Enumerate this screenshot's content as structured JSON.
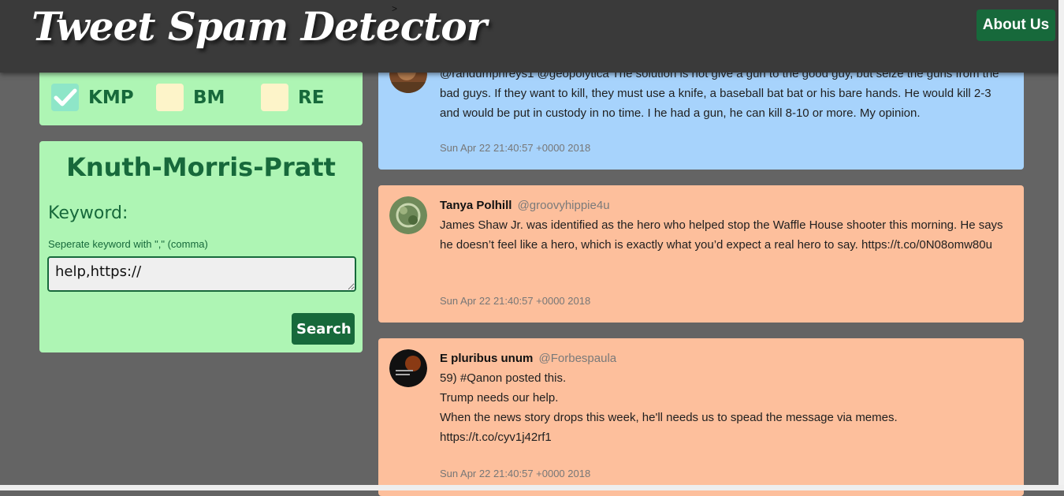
{
  "header": {
    "brand": "Tweet Spam Detector",
    "about_label": "About Us",
    "caret": ">"
  },
  "algorithms": {
    "options": [
      {
        "label": "KMP",
        "checked": true
      },
      {
        "label": "BM",
        "checked": false
      },
      {
        "label": "RE",
        "checked": false
      }
    ]
  },
  "search": {
    "title": "Knuth-Morris-Pratt",
    "keyword_label": "Keyword:",
    "hint": "Seperate keyword with \",\" (comma)",
    "value": "help,https://",
    "button_label": "Search"
  },
  "tweets": [
    {
      "name": "",
      "handle": "",
      "text": "@randumphreys1 @geopolytica The solution is not give a gun to the good guy, but seize the guns from the bad guys. If they want to kill, they must use a knife, a baseball bat bat or his bare hands. He would kill 2-3 and would be put in custody in no time. I he had a gun, he can kill 8-10 or more. My opinion.",
      "time": "Sun Apr 22 21:40:57 +0000 2018",
      "spam": false
    },
    {
      "name": "Tanya Polhill",
      "handle": "@groovyhippie4u",
      "text": "James Shaw Jr. was identified as the hero who helped stop the Waffle House shooter this morning. He says he doesn’t feel like a hero, which is exactly what you’d expect a real hero to say. https://t.co/0N08omw80u",
      "time": "Sun Apr 22 21:40:57 +0000 2018",
      "spam": true
    },
    {
      "name": "E pluribus unum",
      "handle": "@Forbespaula",
      "text": "59) #Qanon posted this.\nTrump needs our help.\nWhen the news story drops this week, he'll needs us to spead the message via memes.\nhttps://t.co/cyv1j42rf1",
      "time": "Sun Apr 22 21:40:57 +0000 2018",
      "spam": true
    }
  ],
  "colors": {
    "header_bg": "#3a3a3a",
    "page_bg": "#646464",
    "panel_bg": "#aef5b4",
    "accent": "#17693b",
    "tweet_normal": "#a7d3fc",
    "tweet_spam": "#fdbf9c"
  }
}
